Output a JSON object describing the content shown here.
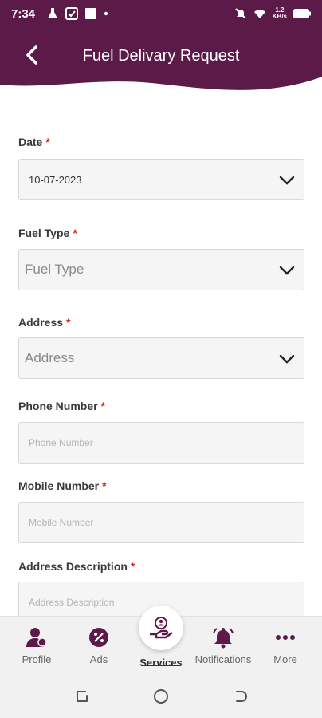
{
  "status_bar": {
    "time": "7:34",
    "speed": "1.2",
    "speed_unit": "KB/s"
  },
  "header": {
    "title": "Fuel Delivary Request",
    "background_color": "#5c1a48"
  },
  "form": {
    "date": {
      "label": "Date",
      "required": "*",
      "value": "10-07-2023"
    },
    "fuel_type": {
      "label": "Fuel Type",
      "required": "*",
      "placeholder": "Fuel Type"
    },
    "address": {
      "label": "Address",
      "required": "*",
      "placeholder": "Address"
    },
    "phone": {
      "label": "Phone Number",
      "required": "*",
      "placeholder": "Phone Number"
    },
    "mobile": {
      "label": "Mobile Number",
      "required": "*",
      "placeholder": "Mobile Number"
    },
    "address_desc": {
      "label": "Address Description",
      "required": "*",
      "placeholder": "Address Description"
    }
  },
  "bottom_nav": {
    "items": [
      {
        "label": "Profile",
        "icon": "profile-icon"
      },
      {
        "label": "Ads",
        "icon": "ads-icon"
      },
      {
        "label": "Services",
        "icon": "services-icon",
        "active": true
      },
      {
        "label": "Notifications",
        "icon": "bell-icon"
      },
      {
        "label": "More",
        "icon": "more-icon"
      }
    ],
    "accent_color": "#5c1a48"
  }
}
